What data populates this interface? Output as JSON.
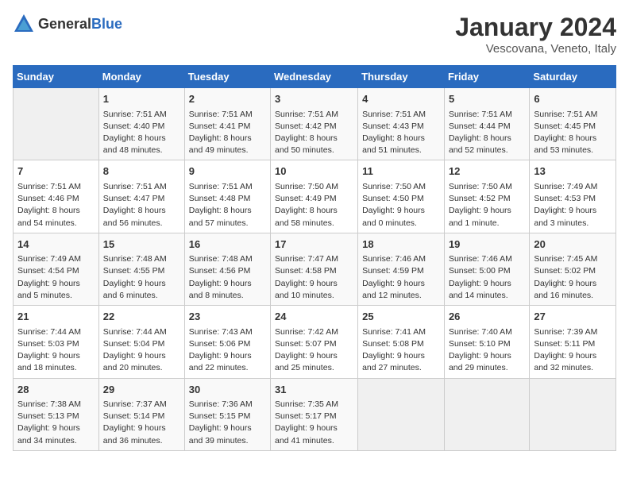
{
  "header": {
    "logo_general": "General",
    "logo_blue": "Blue",
    "title": "January 2024",
    "subtitle": "Vescovana, Veneto, Italy"
  },
  "days_of_week": [
    "Sunday",
    "Monday",
    "Tuesday",
    "Wednesday",
    "Thursday",
    "Friday",
    "Saturday"
  ],
  "weeks": [
    [
      {
        "day": "",
        "info": ""
      },
      {
        "day": "1",
        "info": "Sunrise: 7:51 AM\nSunset: 4:40 PM\nDaylight: 8 hours\nand 48 minutes."
      },
      {
        "day": "2",
        "info": "Sunrise: 7:51 AM\nSunset: 4:41 PM\nDaylight: 8 hours\nand 49 minutes."
      },
      {
        "day": "3",
        "info": "Sunrise: 7:51 AM\nSunset: 4:42 PM\nDaylight: 8 hours\nand 50 minutes."
      },
      {
        "day": "4",
        "info": "Sunrise: 7:51 AM\nSunset: 4:43 PM\nDaylight: 8 hours\nand 51 minutes."
      },
      {
        "day": "5",
        "info": "Sunrise: 7:51 AM\nSunset: 4:44 PM\nDaylight: 8 hours\nand 52 minutes."
      },
      {
        "day": "6",
        "info": "Sunrise: 7:51 AM\nSunset: 4:45 PM\nDaylight: 8 hours\nand 53 minutes."
      }
    ],
    [
      {
        "day": "7",
        "info": "Sunrise: 7:51 AM\nSunset: 4:46 PM\nDaylight: 8 hours\nand 54 minutes."
      },
      {
        "day": "8",
        "info": "Sunrise: 7:51 AM\nSunset: 4:47 PM\nDaylight: 8 hours\nand 56 minutes."
      },
      {
        "day": "9",
        "info": "Sunrise: 7:51 AM\nSunset: 4:48 PM\nDaylight: 8 hours\nand 57 minutes."
      },
      {
        "day": "10",
        "info": "Sunrise: 7:50 AM\nSunset: 4:49 PM\nDaylight: 8 hours\nand 58 minutes."
      },
      {
        "day": "11",
        "info": "Sunrise: 7:50 AM\nSunset: 4:50 PM\nDaylight: 9 hours\nand 0 minutes."
      },
      {
        "day": "12",
        "info": "Sunrise: 7:50 AM\nSunset: 4:52 PM\nDaylight: 9 hours\nand 1 minute."
      },
      {
        "day": "13",
        "info": "Sunrise: 7:49 AM\nSunset: 4:53 PM\nDaylight: 9 hours\nand 3 minutes."
      }
    ],
    [
      {
        "day": "14",
        "info": "Sunrise: 7:49 AM\nSunset: 4:54 PM\nDaylight: 9 hours\nand 5 minutes."
      },
      {
        "day": "15",
        "info": "Sunrise: 7:48 AM\nSunset: 4:55 PM\nDaylight: 9 hours\nand 6 minutes."
      },
      {
        "day": "16",
        "info": "Sunrise: 7:48 AM\nSunset: 4:56 PM\nDaylight: 9 hours\nand 8 minutes."
      },
      {
        "day": "17",
        "info": "Sunrise: 7:47 AM\nSunset: 4:58 PM\nDaylight: 9 hours\nand 10 minutes."
      },
      {
        "day": "18",
        "info": "Sunrise: 7:46 AM\nSunset: 4:59 PM\nDaylight: 9 hours\nand 12 minutes."
      },
      {
        "day": "19",
        "info": "Sunrise: 7:46 AM\nSunset: 5:00 PM\nDaylight: 9 hours\nand 14 minutes."
      },
      {
        "day": "20",
        "info": "Sunrise: 7:45 AM\nSunset: 5:02 PM\nDaylight: 9 hours\nand 16 minutes."
      }
    ],
    [
      {
        "day": "21",
        "info": "Sunrise: 7:44 AM\nSunset: 5:03 PM\nDaylight: 9 hours\nand 18 minutes."
      },
      {
        "day": "22",
        "info": "Sunrise: 7:44 AM\nSunset: 5:04 PM\nDaylight: 9 hours\nand 20 minutes."
      },
      {
        "day": "23",
        "info": "Sunrise: 7:43 AM\nSunset: 5:06 PM\nDaylight: 9 hours\nand 22 minutes."
      },
      {
        "day": "24",
        "info": "Sunrise: 7:42 AM\nSunset: 5:07 PM\nDaylight: 9 hours\nand 25 minutes."
      },
      {
        "day": "25",
        "info": "Sunrise: 7:41 AM\nSunset: 5:08 PM\nDaylight: 9 hours\nand 27 minutes."
      },
      {
        "day": "26",
        "info": "Sunrise: 7:40 AM\nSunset: 5:10 PM\nDaylight: 9 hours\nand 29 minutes."
      },
      {
        "day": "27",
        "info": "Sunrise: 7:39 AM\nSunset: 5:11 PM\nDaylight: 9 hours\nand 32 minutes."
      }
    ],
    [
      {
        "day": "28",
        "info": "Sunrise: 7:38 AM\nSunset: 5:13 PM\nDaylight: 9 hours\nand 34 minutes."
      },
      {
        "day": "29",
        "info": "Sunrise: 7:37 AM\nSunset: 5:14 PM\nDaylight: 9 hours\nand 36 minutes."
      },
      {
        "day": "30",
        "info": "Sunrise: 7:36 AM\nSunset: 5:15 PM\nDaylight: 9 hours\nand 39 minutes."
      },
      {
        "day": "31",
        "info": "Sunrise: 7:35 AM\nSunset: 5:17 PM\nDaylight: 9 hours\nand 41 minutes."
      },
      {
        "day": "",
        "info": ""
      },
      {
        "day": "",
        "info": ""
      },
      {
        "day": "",
        "info": ""
      }
    ]
  ]
}
